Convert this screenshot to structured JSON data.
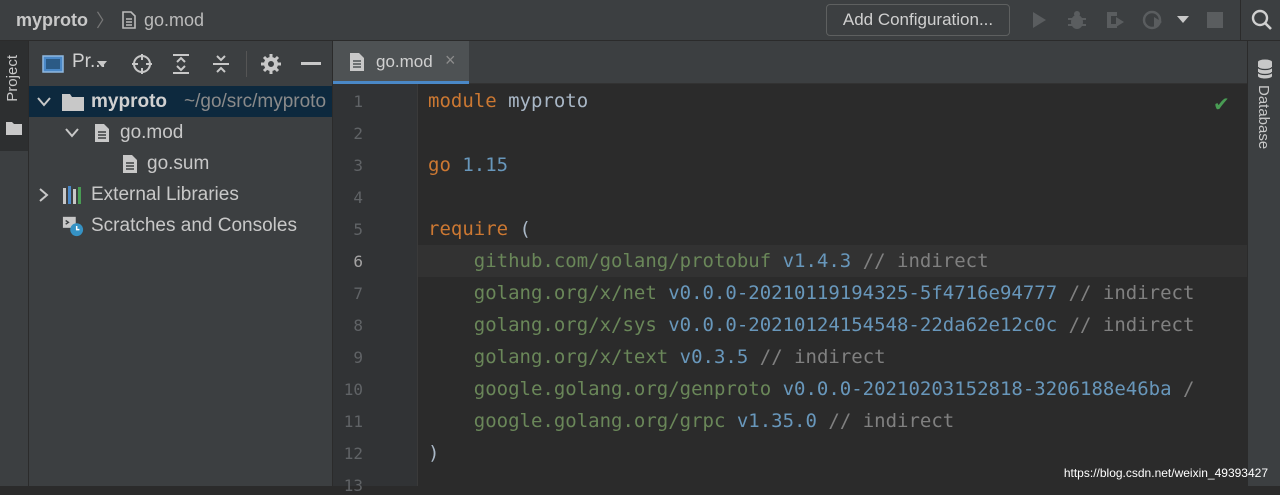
{
  "breadcrumb": {
    "project": "myproto",
    "file": "go.mod"
  },
  "toolbar": {
    "add_config_label": "Add Configuration..."
  },
  "left_strip": {
    "project_label": "Project"
  },
  "right_strip": {
    "database_label": "Database"
  },
  "project_panel": {
    "title": "Pr...",
    "tree": [
      {
        "label": "myproto",
        "path": "~/go/src/myproto"
      },
      {
        "label": "go.mod"
      },
      {
        "label": "go.sum"
      },
      {
        "label": "External Libraries"
      },
      {
        "label": "Scratches and Consoles"
      }
    ]
  },
  "editor": {
    "tab_label": "go.mod",
    "current_line": 6,
    "lines": [
      {
        "num": "1",
        "tokens": [
          {
            "t": "module ",
            "c": "kw"
          },
          {
            "t": "myproto",
            "c": "plain"
          }
        ]
      },
      {
        "num": "2",
        "tokens": []
      },
      {
        "num": "3",
        "tokens": [
          {
            "t": "go ",
            "c": "kw"
          },
          {
            "t": "1.15",
            "c": "num"
          }
        ]
      },
      {
        "num": "4",
        "tokens": []
      },
      {
        "num": "5",
        "tokens": [
          {
            "t": "require ",
            "c": "kw"
          },
          {
            "t": "(",
            "c": "plain"
          }
        ]
      },
      {
        "num": "6",
        "tokens": [
          {
            "t": "    github.com/golang/protobuf ",
            "c": "pkg"
          },
          {
            "t": "v1.4.3 ",
            "c": "ver"
          },
          {
            "t": "// indirect",
            "c": "cm"
          }
        ]
      },
      {
        "num": "7",
        "tokens": [
          {
            "t": "    golang.org/x/net ",
            "c": "pkg"
          },
          {
            "t": "v0.0.0-20210119194325-5f4716e94777 ",
            "c": "ver"
          },
          {
            "t": "// indirect",
            "c": "cm"
          }
        ]
      },
      {
        "num": "8",
        "tokens": [
          {
            "t": "    golang.org/x/sys ",
            "c": "pkg"
          },
          {
            "t": "v0.0.0-20210124154548-22da62e12c0c ",
            "c": "ver"
          },
          {
            "t": "// indirect",
            "c": "cm"
          }
        ]
      },
      {
        "num": "9",
        "tokens": [
          {
            "t": "    golang.org/x/text ",
            "c": "pkg"
          },
          {
            "t": "v0.3.5 ",
            "c": "ver"
          },
          {
            "t": "// indirect",
            "c": "cm"
          }
        ]
      },
      {
        "num": "10",
        "tokens": [
          {
            "t": "    google.golang.org/genproto ",
            "c": "pkg"
          },
          {
            "t": "v0.0.0-20210203152818-3206188e46ba ",
            "c": "ver"
          },
          {
            "t": "/",
            "c": "cm"
          }
        ]
      },
      {
        "num": "11",
        "tokens": [
          {
            "t": "    google.golang.org/grpc ",
            "c": "pkg"
          },
          {
            "t": "v1.35.0 ",
            "c": "ver"
          },
          {
            "t": "// indirect",
            "c": "cm"
          }
        ]
      },
      {
        "num": "12",
        "tokens": [
          {
            "t": ")",
            "c": "plain"
          }
        ]
      },
      {
        "num": "13",
        "tokens": []
      }
    ]
  },
  "watermark": "https://blog.csdn.net/weixin_49393427"
}
